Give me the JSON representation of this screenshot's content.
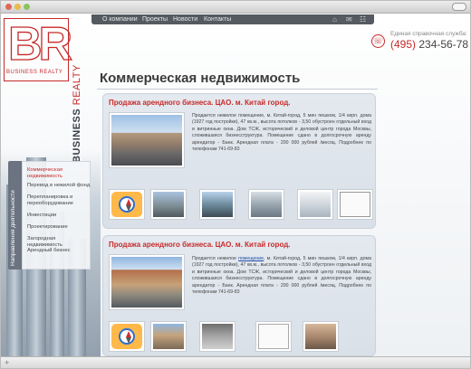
{
  "logo": {
    "letters": "BR",
    "subtitle": "BUSINESS REALTY"
  },
  "nav": {
    "items": [
      "О компании",
      "Проекты",
      "Новости",
      "Контакты"
    ],
    "icons": [
      "home-icon",
      "mail-icon",
      "sitemap-icon"
    ]
  },
  "contact": {
    "caption": "Единая справочная служба:",
    "code": "(495)",
    "number": "234-56-78"
  },
  "vertical_brand": {
    "bold": "BUSINESS",
    "light": "REALTY"
  },
  "page_title": "Коммерческая недвижимость",
  "sidebar": {
    "tab_label": "Направления деятельности",
    "items": [
      "Коммерческая недвижимость",
      "Перевод в нежилой фонд",
      "Перепланировка и переоборудование",
      "Инвестиции",
      "Проектирование",
      "Загородная недвижимость",
      "Арендный бизнес"
    ]
  },
  "listings": [
    {
      "title": "Продажа арендного бизнеса. ЦАО. м. Китай город.",
      "text": "Продается нежилое помещение, м. Китай-город, 5 мин пешком, 1/4 кирп. дома (1927 год постройки), 47 кв.м., высота потолков - 3,50 обустроен отдельный вход и витринные окна. Дом ТСЖ, исторический и деловой центр города Москвы, сложившаяся бизнесструктура. Помещение сдано в долгосрочную аренду арендатор - Банк. Арендная плата - 200 000 рублей /месяц. Подробнее по телефонам 741-69-83"
    },
    {
      "title": "Продажа арендного бизнеса. ЦАО. м. Китай город.",
      "text_before": "Продается нежилое ",
      "text_link": "помещение",
      "text_after": ", м. Китай-город, 5 мин пешком, 1/4 кирп. дома (1927 год постройки), 47 кв.м., высота потолков - 3,50 обустроен отдельный вход и витринные окна. Дом ТСЖ, исторический и деловой центр города Москвы, сложившаяся бизнесструктура. Помещение сдано в долгосрочную аренду арендатор - Банк. Арендная плата - 200 000 рублей /месяц. Подробнее по телефонам 741-69-83"
    }
  ],
  "colors": {
    "accent": "#c72a2a",
    "nav_bg": "#555a60",
    "card_bg": "#e4e9ef"
  }
}
